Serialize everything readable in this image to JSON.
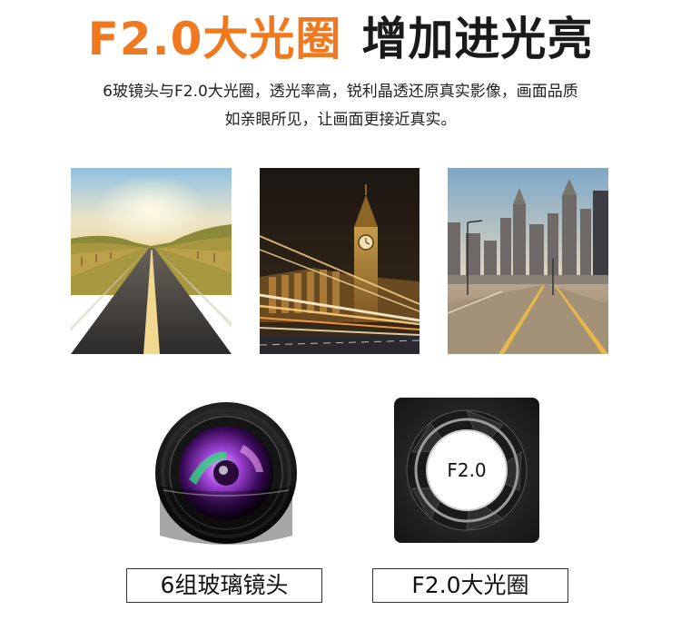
{
  "headline": {
    "accent_text": "F2.0大光圈",
    "dark_text": "增加进光亮",
    "accent_color": "#f07920"
  },
  "description": {
    "line1": "6玻镜头与F2.0大光圈，透光率高，锐利晶透还原真实影像，画面品质",
    "line2": "如亲眼所见，让画面更接近真实。"
  },
  "photos": [
    {
      "subject": "countryside-road"
    },
    {
      "subject": "big-ben-night-traffic"
    },
    {
      "subject": "city-street-skyline"
    }
  ],
  "features": {
    "lens_caption": "6组玻璃镜头",
    "aperture_caption": "F2.0大光圈",
    "aperture_label": "F2.0"
  }
}
